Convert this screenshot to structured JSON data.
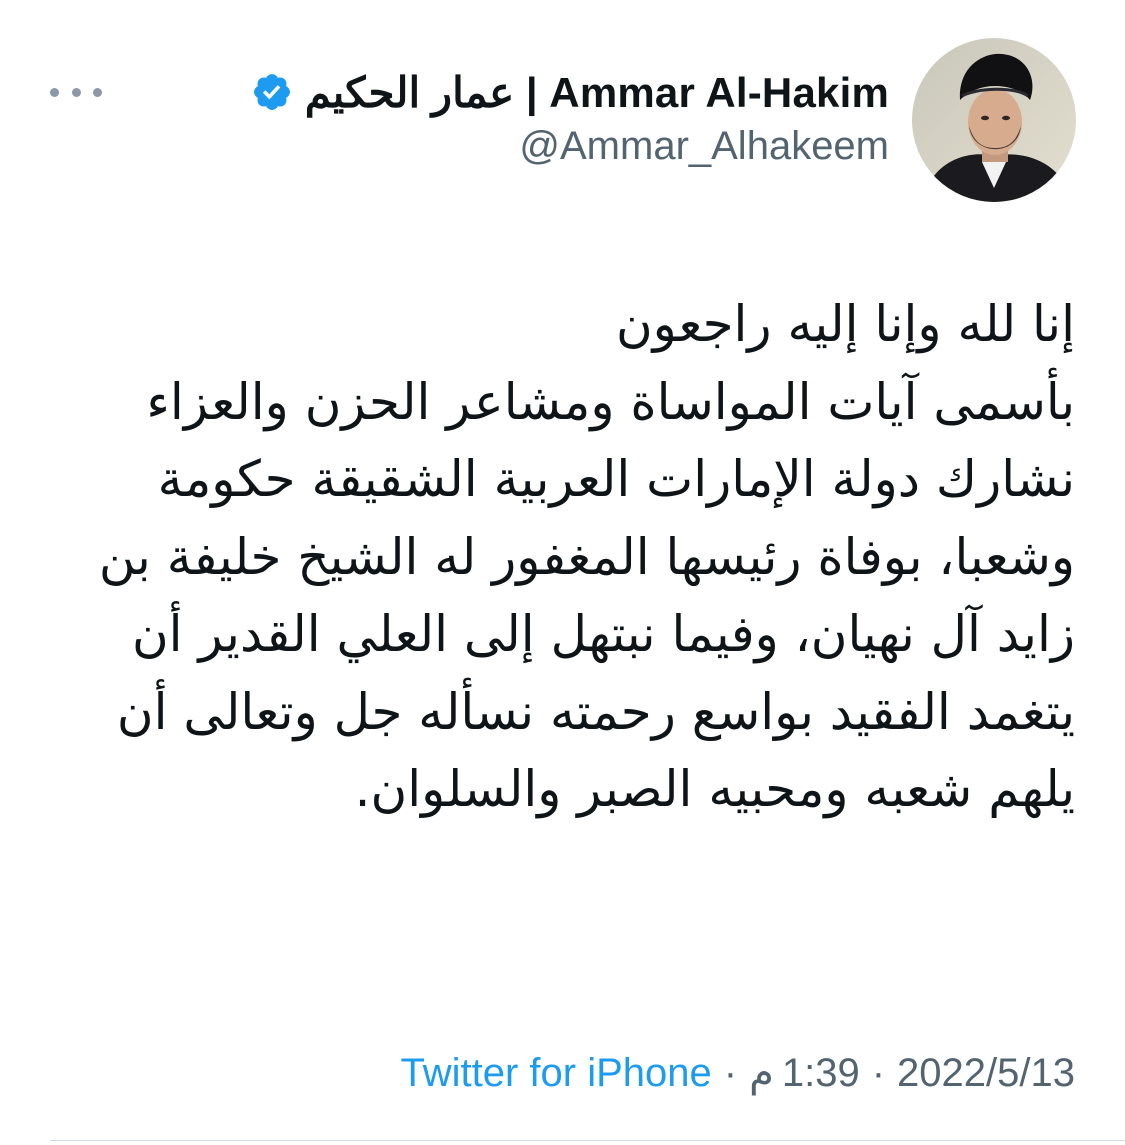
{
  "author": {
    "display_name": "عمار الحكيم | Ammar Al-Hakim",
    "handle": "@Ammar_Alhakeem",
    "verified": true,
    "avatar_icon": "profile-photo"
  },
  "tweet": {
    "text": "إنا لله وإنا إليه راجعون\nبأسمى آيات المواساة ومشاعر الحزن والعزاء نشارك دولة الإمارات العربية الشقيقة حكومة وشعبا، بوفاة رئيسها المغفور له الشيخ خليفة بن زايد آل نهيان، وفيما نبتهل إلى العلي القدير أن يتغمد الفقيد بواسع رحمته نسأله جل وتعالى أن يلهم شعبه ومحبيه الصبر والسلوان."
  },
  "meta": {
    "date": "2022/5/13",
    "time": "1:39",
    "ampm": "م",
    "separator": "·",
    "source": "Twitter for iPhone"
  },
  "icons": {
    "more": "more-horizontal-icon",
    "verified": "verified-badge-icon"
  },
  "colors": {
    "accent": "#1d9bf0",
    "secondary_text": "#536471",
    "primary_text": "#0f1419",
    "dots": "#8b98a5"
  }
}
